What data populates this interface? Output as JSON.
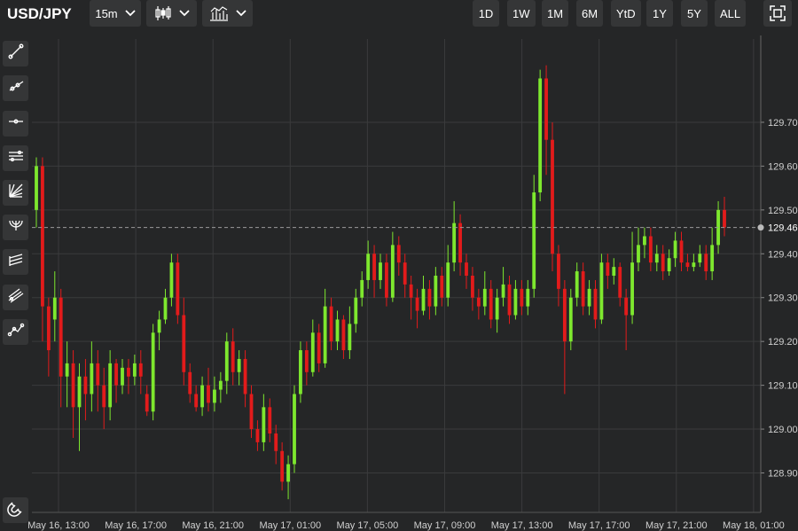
{
  "header": {
    "symbol": "USD/JPY",
    "interval": "15m",
    "chart_type_icon": "candlestick-icon",
    "indicator_icon": "indicators-icon",
    "dropdown_icon": "chevron-down-icon",
    "ranges": [
      "1D",
      "1W",
      "1M",
      "6M",
      "YtD",
      "1Y",
      "5Y",
      "ALL"
    ],
    "fullscreen_icon": "fullscreen-icon"
  },
  "sidebar": {
    "tools": [
      "trend-line-icon",
      "ray-icon",
      "horizontal-line-icon",
      "parallel-channel-icon",
      "fib-fan-icon",
      "fib-arc-icon",
      "fib-retracement-icon",
      "pitchfork-icon",
      "path-icon"
    ],
    "magnet_icon": "magnet-icon"
  },
  "colors": {
    "up": "#7ee82e",
    "down": "#e21b1b",
    "background": "#252627",
    "grid": "#3a3b3c",
    "axis_text": "#d0d0d0"
  },
  "chart_data": {
    "type": "candlestick",
    "series_name": "USD/JPY",
    "interval": "15m",
    "current_price": "129.46",
    "y_ticks": [
      "129.70",
      "129.60",
      "129.50",
      "129.40",
      "129.30",
      "129.20",
      "129.10",
      "129.00",
      "128.90"
    ],
    "x_ticks": [
      "May 16, 13:00",
      "May 16, 17:00",
      "May 16, 21:00",
      "May 17, 01:00",
      "May 17, 05:00",
      "May 17, 09:00",
      "May 17, 13:00",
      "May 17, 17:00",
      "May 17, 21:00",
      "May 18, 01:00"
    ],
    "ylim": [
      128.81,
      129.89
    ],
    "grid": true,
    "candles": [
      [
        129.5,
        129.6,
        129.62,
        129.46
      ],
      [
        129.6,
        129.28,
        129.62,
        129.2
      ],
      [
        129.28,
        129.18,
        129.3,
        129.12
      ],
      [
        129.25,
        129.3,
        129.36,
        129.2
      ],
      [
        129.3,
        129.12,
        129.32,
        129.05
      ],
      [
        129.12,
        129.15,
        129.2,
        129.05
      ],
      [
        129.15,
        129.05,
        129.18,
        128.98
      ],
      [
        129.05,
        129.12,
        129.15,
        128.95
      ],
      [
        129.12,
        129.08,
        129.16,
        129.02
      ],
      [
        129.08,
        129.15,
        129.2,
        129.04
      ],
      [
        129.15,
        129.1,
        129.18,
        129.04
      ],
      [
        129.1,
        129.05,
        129.14,
        129.0
      ],
      [
        129.05,
        129.15,
        129.18,
        129.02
      ],
      [
        129.15,
        129.1,
        129.16,
        129.06
      ],
      [
        129.1,
        129.14,
        129.16,
        129.08
      ],
      [
        129.14,
        129.12,
        129.16,
        129.08
      ],
      [
        129.12,
        129.15,
        129.17,
        129.1
      ],
      [
        129.15,
        129.12,
        129.18,
        129.08
      ],
      [
        129.08,
        129.04,
        129.1,
        129.03
      ],
      [
        129.04,
        129.22,
        129.24,
        129.02
      ],
      [
        129.22,
        129.25,
        129.27,
        129.18
      ],
      [
        129.25,
        129.3,
        129.32,
        129.24
      ],
      [
        129.3,
        129.38,
        129.4,
        129.28
      ],
      [
        129.38,
        129.26,
        129.4,
        129.24
      ],
      [
        129.26,
        129.13,
        129.3,
        129.1
      ],
      [
        129.13,
        129.08,
        129.15,
        129.06
      ],
      [
        129.08,
        129.05,
        129.1,
        129.04
      ],
      [
        129.05,
        129.1,
        129.12,
        129.03
      ],
      [
        129.1,
        129.06,
        129.14,
        129.04
      ],
      [
        129.06,
        129.09,
        129.12,
        129.04
      ],
      [
        129.09,
        129.11,
        129.13,
        129.06
      ],
      [
        129.11,
        129.2,
        129.22,
        129.08
      ],
      [
        129.2,
        129.13,
        129.23,
        129.1
      ],
      [
        129.13,
        129.16,
        129.18,
        129.1
      ],
      [
        129.16,
        129.08,
        129.18,
        129.05
      ],
      [
        129.08,
        129.0,
        129.1,
        128.98
      ],
      [
        129.0,
        128.97,
        129.02,
        128.95
      ],
      [
        128.97,
        129.05,
        129.08,
        128.95
      ],
      [
        129.05,
        128.99,
        129.07,
        128.97
      ],
      [
        128.99,
        128.95,
        129.01,
        128.92
      ],
      [
        128.95,
        128.88,
        128.97,
        128.86
      ],
      [
        128.88,
        128.92,
        128.94,
        128.84
      ],
      [
        128.92,
        129.08,
        129.1,
        128.9
      ],
      [
        129.08,
        129.18,
        129.2,
        129.06
      ],
      [
        129.18,
        129.13,
        129.2,
        129.1
      ],
      [
        129.13,
        129.22,
        129.25,
        129.12
      ],
      [
        129.22,
        129.15,
        129.24,
        129.13
      ],
      [
        129.15,
        129.28,
        129.32,
        129.14
      ],
      [
        129.28,
        129.2,
        129.3,
        129.18
      ],
      [
        129.2,
        129.25,
        129.27,
        129.18
      ],
      [
        129.25,
        129.18,
        129.26,
        129.16
      ],
      [
        129.18,
        129.24,
        129.28,
        129.16
      ],
      [
        129.24,
        129.3,
        129.32,
        129.22
      ],
      [
        129.3,
        129.34,
        129.36,
        129.28
      ],
      [
        129.34,
        129.4,
        129.43,
        129.32
      ],
      [
        129.4,
        129.34,
        129.42,
        129.3
      ],
      [
        129.34,
        129.38,
        129.4,
        129.32
      ],
      [
        129.38,
        129.3,
        129.4,
        129.28
      ],
      [
        129.3,
        129.42,
        129.45,
        129.29
      ],
      [
        129.42,
        129.38,
        129.44,
        129.35
      ],
      [
        129.38,
        129.33,
        129.4,
        129.3
      ],
      [
        129.33,
        129.3,
        129.35,
        129.25
      ],
      [
        129.3,
        129.27,
        129.32,
        129.23
      ],
      [
        129.27,
        129.32,
        129.35,
        129.26
      ],
      [
        129.32,
        129.28,
        129.34,
        129.25
      ],
      [
        129.28,
        129.35,
        129.37,
        129.26
      ],
      [
        129.35,
        129.3,
        129.37,
        129.28
      ],
      [
        129.3,
        129.38,
        129.42,
        129.28
      ],
      [
        129.38,
        129.47,
        129.52,
        129.36
      ],
      [
        129.47,
        129.38,
        129.49,
        129.35
      ],
      [
        129.38,
        129.35,
        129.4,
        129.32
      ],
      [
        129.35,
        129.3,
        129.37,
        129.27
      ],
      [
        129.3,
        129.28,
        129.32,
        129.25
      ],
      [
        129.28,
        129.32,
        129.36,
        129.26
      ],
      [
        129.32,
        129.25,
        129.34,
        129.23
      ],
      [
        129.25,
        129.3,
        129.32,
        129.22
      ],
      [
        129.3,
        129.33,
        129.37,
        129.28
      ],
      [
        129.33,
        129.26,
        129.35,
        129.24
      ],
      [
        129.26,
        129.32,
        129.34,
        129.25
      ],
      [
        129.32,
        129.28,
        129.34,
        129.26
      ],
      [
        129.28,
        129.32,
        129.34,
        129.26
      ],
      [
        129.32,
        129.54,
        129.58,
        129.3
      ],
      [
        129.54,
        129.8,
        129.82,
        129.52
      ],
      [
        129.8,
        129.66,
        129.83,
        129.58
      ],
      [
        129.66,
        129.4,
        129.7,
        129.36
      ],
      [
        129.4,
        129.32,
        129.42,
        129.28
      ],
      [
        129.32,
        129.2,
        129.34,
        129.08
      ],
      [
        129.2,
        129.3,
        129.32,
        129.18
      ],
      [
        129.3,
        129.36,
        129.38,
        129.28
      ],
      [
        129.36,
        129.28,
        129.38,
        129.26
      ],
      [
        129.28,
        129.32,
        129.34,
        129.26
      ],
      [
        129.32,
        129.25,
        129.34,
        129.23
      ],
      [
        129.25,
        129.38,
        129.4,
        129.24
      ],
      [
        129.38,
        129.35,
        129.4,
        129.32
      ],
      [
        129.35,
        129.37,
        129.39,
        129.33
      ],
      [
        129.37,
        129.3,
        129.38,
        129.28
      ],
      [
        129.3,
        129.26,
        129.32,
        129.18
      ],
      [
        129.26,
        129.38,
        129.45,
        129.24
      ],
      [
        129.38,
        129.42,
        129.46,
        129.36
      ],
      [
        129.42,
        129.44,
        129.46,
        129.39
      ],
      [
        129.44,
        129.38,
        129.46,
        129.36
      ],
      [
        129.38,
        129.4,
        129.42,
        129.36
      ],
      [
        129.4,
        129.36,
        129.42,
        129.34
      ],
      [
        129.36,
        129.39,
        129.41,
        129.35
      ],
      [
        129.39,
        129.43,
        129.45,
        129.37
      ],
      [
        129.43,
        129.38,
        129.45,
        129.36
      ],
      [
        129.38,
        129.37,
        129.4,
        129.36
      ],
      [
        129.37,
        129.38,
        129.4,
        129.36
      ],
      [
        129.38,
        129.4,
        129.42,
        129.37
      ],
      [
        129.4,
        129.36,
        129.42,
        129.34
      ],
      [
        129.36,
        129.42,
        129.46,
        129.34
      ],
      [
        129.42,
        129.5,
        129.52,
        129.4
      ],
      [
        129.5,
        129.46,
        129.53,
        129.44
      ]
    ]
  }
}
